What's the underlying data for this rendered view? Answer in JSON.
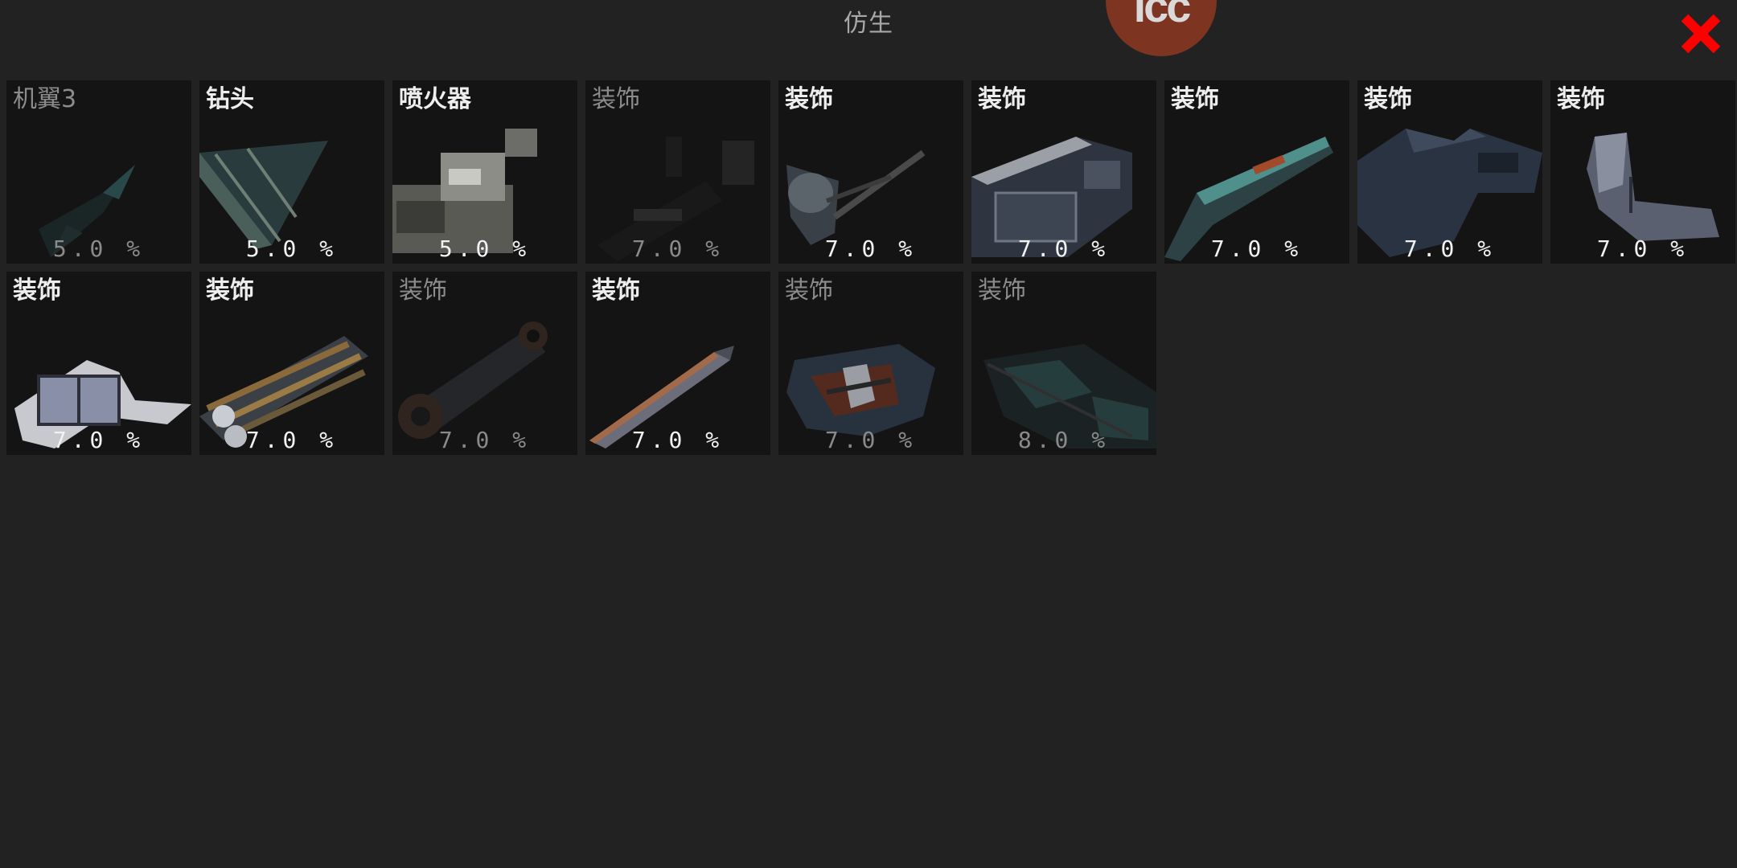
{
  "header": {
    "title": "仿生",
    "logo_text": "icc",
    "close_icon": "close-x-icon",
    "close_color": "#ff0000"
  },
  "colors": {
    "background": "#222222",
    "tile": "#141414",
    "logo": "#7d3421"
  },
  "items": [
    {
      "name": "机翼3",
      "percent": "5.0 %",
      "available": false,
      "icon": "wing-part-icon"
    },
    {
      "name": "钻头",
      "percent": "5.0 %",
      "available": true,
      "icon": "drill-part-icon"
    },
    {
      "name": "喷火器",
      "percent": "5.0 %",
      "available": true,
      "icon": "flamethrower-part-icon"
    },
    {
      "name": "装饰",
      "percent": "7.0 %",
      "available": false,
      "icon": "rifle-decoration-icon"
    },
    {
      "name": "装饰",
      "percent": "7.0 %",
      "available": true,
      "icon": "antenna-decoration-icon"
    },
    {
      "name": "装饰",
      "percent": "7.0 %",
      "available": true,
      "icon": "plate-decoration-icon"
    },
    {
      "name": "装饰",
      "percent": "7.0 %",
      "available": true,
      "icon": "rail-decoration-icon"
    },
    {
      "name": "装饰",
      "percent": "7.0 %",
      "available": true,
      "icon": "hull-decoration-icon"
    },
    {
      "name": "装饰",
      "percent": "7.0 %",
      "available": true,
      "icon": "fin-decoration-icon"
    },
    {
      "name": "装饰",
      "percent": "7.0 %",
      "available": true,
      "icon": "panel-decoration-icon"
    },
    {
      "name": "装饰",
      "percent": "7.0 %",
      "available": true,
      "icon": "tubes-decoration-icon"
    },
    {
      "name": "装饰",
      "percent": "7.0 %",
      "available": false,
      "icon": "arm-decoration-icon"
    },
    {
      "name": "装饰",
      "percent": "7.0 %",
      "available": true,
      "icon": "blade-decoration-icon"
    },
    {
      "name": "装饰",
      "percent": "7.0 %",
      "available": false,
      "icon": "turret-decoration-icon"
    },
    {
      "name": "装饰",
      "percent": "8.0 %",
      "available": false,
      "icon": "armor-decoration-icon"
    }
  ]
}
